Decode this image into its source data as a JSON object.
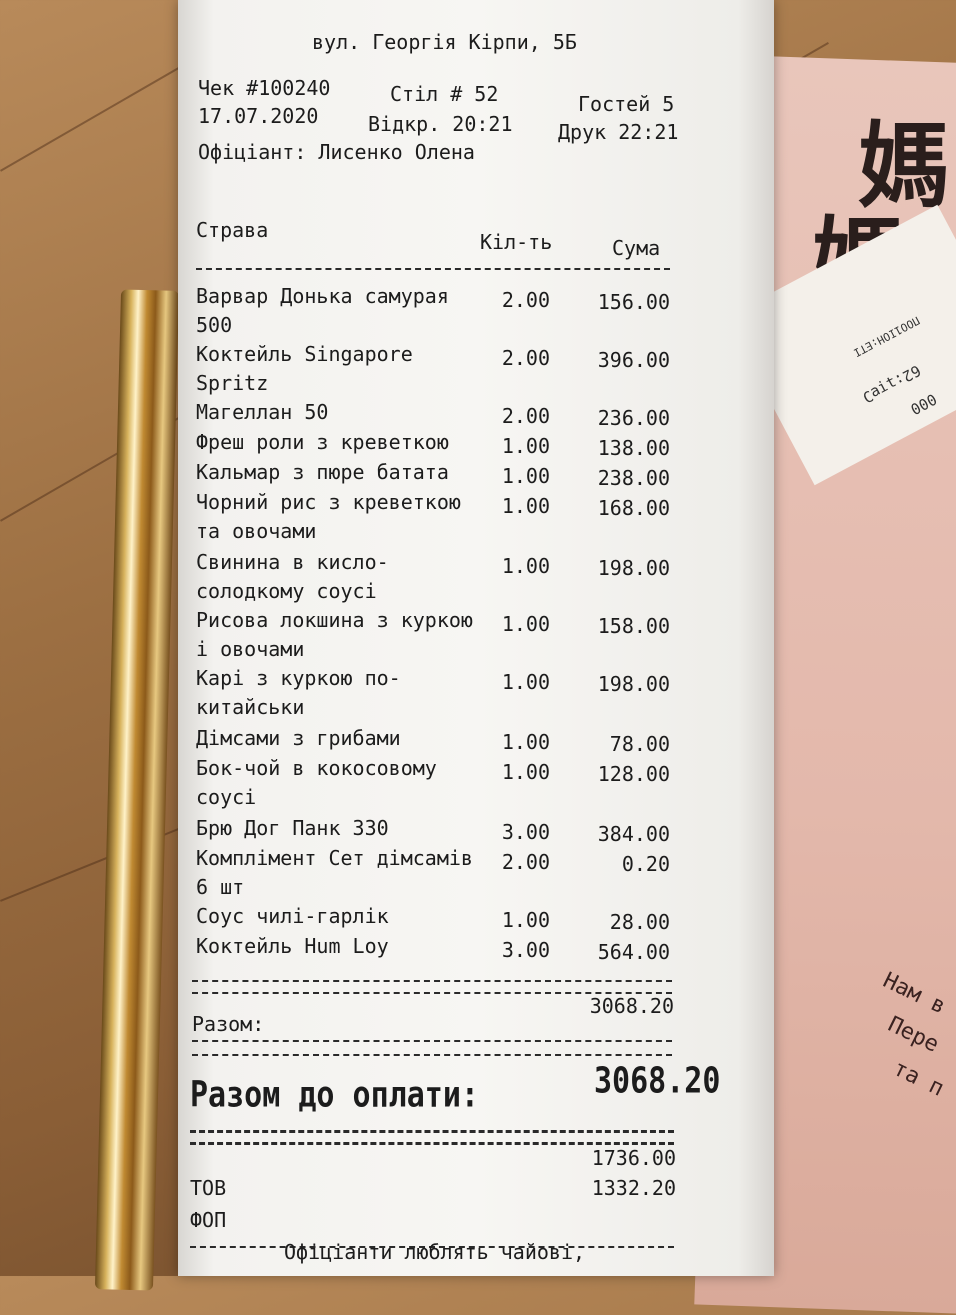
{
  "receipt": {
    "address": "вул. Георгія Кірпи, 5Б",
    "check_no": "Чек #100240",
    "table": "Стіл # 52",
    "guests": "Гостей 5",
    "date": "17.07.2020",
    "opened": "Відкр. 20:21",
    "printed": "Друк 22:21",
    "waiter": "Офіціант: Лисенко Олена",
    "headers": {
      "dish": "Страва",
      "qty": "Кіл-ть",
      "sum": "Сума"
    },
    "items": [
      {
        "name": "Варвар Донька самурая\n500",
        "qty": "2.00",
        "sum": "156.00"
      },
      {
        "name": "Коктейль Singapore\nSpritz",
        "qty": "2.00",
        "sum": "396.00"
      },
      {
        "name": "Магеллан 50",
        "qty": "2.00",
        "sum": "236.00"
      },
      {
        "name": "Фреш роли з креветкою",
        "qty": "1.00",
        "sum": "138.00"
      },
      {
        "name": "Кальмар з пюре батата",
        "qty": "1.00",
        "sum": "238.00"
      },
      {
        "name": "Чорний рис з креветкою\nта овочами",
        "qty": "1.00",
        "sum": "168.00"
      },
      {
        "name": "Свинина в кисло-\nсолодкому соусі",
        "qty": "1.00",
        "sum": "198.00"
      },
      {
        "name": "Рисова локшина з куркою\nі овочами",
        "qty": "1.00",
        "sum": "158.00"
      },
      {
        "name": "Карі з куркою по-\nкитайськи",
        "qty": "1.00",
        "sum": "198.00"
      },
      {
        "name": "Дімсами з грибами",
        "qty": "1.00",
        "sum": "78.00"
      },
      {
        "name": "Бок-чой в кокосовому\nсоусі",
        "qty": "1.00",
        "sum": "128.00"
      },
      {
        "name": "Брю Дог Панк 330",
        "qty": "3.00",
        "sum": "384.00"
      },
      {
        "name": "Комплімент Сет дімсамів\n6 шт",
        "qty": "2.00",
        "sum": "0.20"
      },
      {
        "name": "Соус чилі-гарлік",
        "qty": "1.00",
        "sum": "28.00"
      },
      {
        "name": "Коктейль Hum Loy",
        "qty": "3.00",
        "sum": "564.00"
      }
    ],
    "subtotal_label": "Разом:",
    "subtotal_value": "3068.20",
    "total_label": "Разом до оплати:",
    "total_value": "3068.20",
    "split": [
      {
        "label": "ТОВ",
        "value": "1736.00"
      },
      {
        "label": "ФОП",
        "value": "1332.20"
      }
    ],
    "footer": "Офіціанти люблять чайові,"
  },
  "background": {
    "pink_glyphs": [
      "媽",
      "媽"
    ],
    "pink_text_lines": [
      "Нам в",
      "Пере",
      "та п"
    ],
    "slip_lines": [
      "62:ʇᴉɐƆ",
      "000",
      "ПОО1ІОН:ЕТІ"
    ]
  }
}
